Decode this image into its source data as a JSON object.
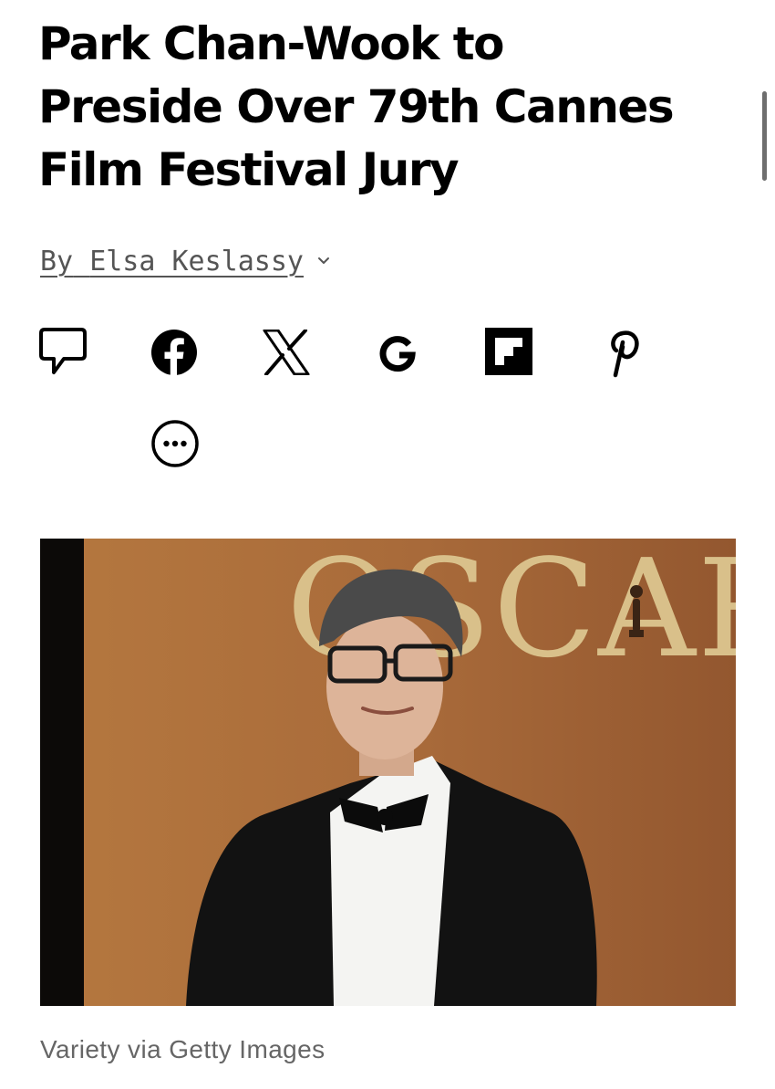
{
  "article": {
    "headline_lines": [
      "Park Chan-Wook to",
      "Preside Over 79th Cannes",
      "Film Festival Jury"
    ],
    "byline": {
      "prefix": "By",
      "author": "Elsa Keslassy"
    },
    "share_icons": [
      "comment-icon",
      "facebook-icon",
      "x-icon",
      "google-icon",
      "flipboard-icon",
      "pinterest-icon",
      "more-icon"
    ],
    "photo": {
      "backdrop_text": "OSCAR",
      "colors": {
        "backdrop": "#a86a3a",
        "letters": "#d9c08a",
        "suit": "#121212",
        "shirt": "#f4f4f2"
      }
    },
    "caption": "Variety via Getty Images"
  }
}
